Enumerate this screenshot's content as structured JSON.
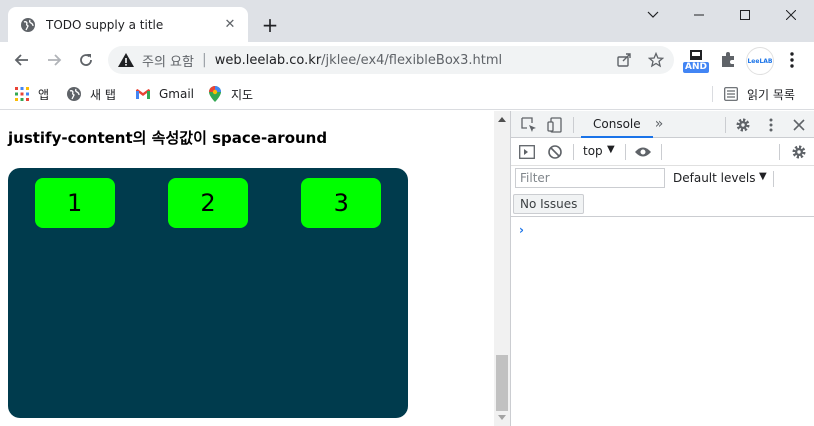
{
  "tab": {
    "title": "TODO supply a title",
    "favicon_icon": "globe-icon"
  },
  "omnibox": {
    "security_label": "주의 요함",
    "host": "web.leelab.co.kr",
    "path": "/jklee/ex4/flexibleBox3.html"
  },
  "extensions": {
    "and_badge": "AND",
    "leelab_label": "LeeLAB"
  },
  "bookmarks": {
    "items": [
      {
        "label": "앱",
        "icon": "apps-grid-icon"
      },
      {
        "label": "새 탭",
        "icon": "globe-icon"
      },
      {
        "label": "Gmail",
        "icon": "gmail-icon"
      },
      {
        "label": "지도",
        "icon": "maps-pin-icon"
      }
    ],
    "reading_list": "읽기 목록"
  },
  "page": {
    "heading": "justify-content의 속성값이 space-around",
    "items": [
      "1",
      "2",
      "3"
    ],
    "container_color": "#003b4d",
    "item_color": "#00ff00"
  },
  "devtools": {
    "tab_console": "Console",
    "context": "top",
    "filter_placeholder": "Filter",
    "levels": "Default levels",
    "no_issues": "No Issues",
    "prompt": "›"
  },
  "colors": {
    "tabstrip": "#dee1e6",
    "accent": "#1a73e8"
  }
}
